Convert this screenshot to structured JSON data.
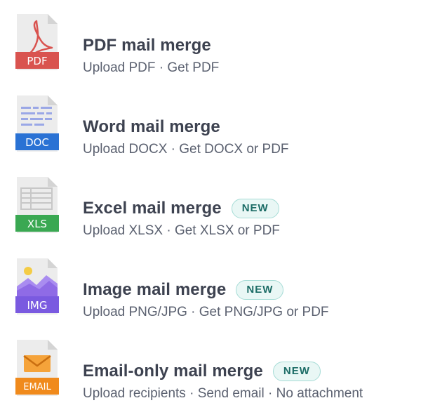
{
  "items": [
    {
      "title": "PDF mail merge",
      "subtitle": "Upload PDF · Get PDF",
      "badge": "",
      "icon": "pdf-file-icon",
      "icon_label": "PDF",
      "accent": "#d9534f"
    },
    {
      "title": "Word mail merge",
      "subtitle": "Upload DOCX · Get DOCX or PDF",
      "badge": "",
      "icon": "doc-file-icon",
      "icon_label": "DOC",
      "accent": "#2a72d4"
    },
    {
      "title": "Excel mail merge",
      "subtitle": "Upload XLSX · Get XLSX or PDF",
      "badge": "NEW",
      "icon": "xls-file-icon",
      "icon_label": "XLS",
      "accent": "#3aa852"
    },
    {
      "title": "Image mail merge",
      "subtitle": "Upload PNG/JPG · Get PNG/JPG or PDF",
      "badge": "NEW",
      "icon": "img-file-icon",
      "icon_label": "IMG",
      "accent": "#7a5ae0"
    },
    {
      "title": "Email-only mail merge",
      "subtitle": "Upload recipients · Send email · No attachment",
      "badge": "NEW",
      "icon": "email-file-icon",
      "icon_label": "EMAIL",
      "accent": "#f08a1c"
    }
  ],
  "colors": {
    "title": "#3d4250",
    "subtitle": "#5b6170",
    "badge_text": "#1c6c66",
    "badge_border": "#a6dcd6",
    "badge_bg": "#e9f7f5",
    "file_page": "#ececec",
    "file_fold": "#d4d4d4"
  }
}
